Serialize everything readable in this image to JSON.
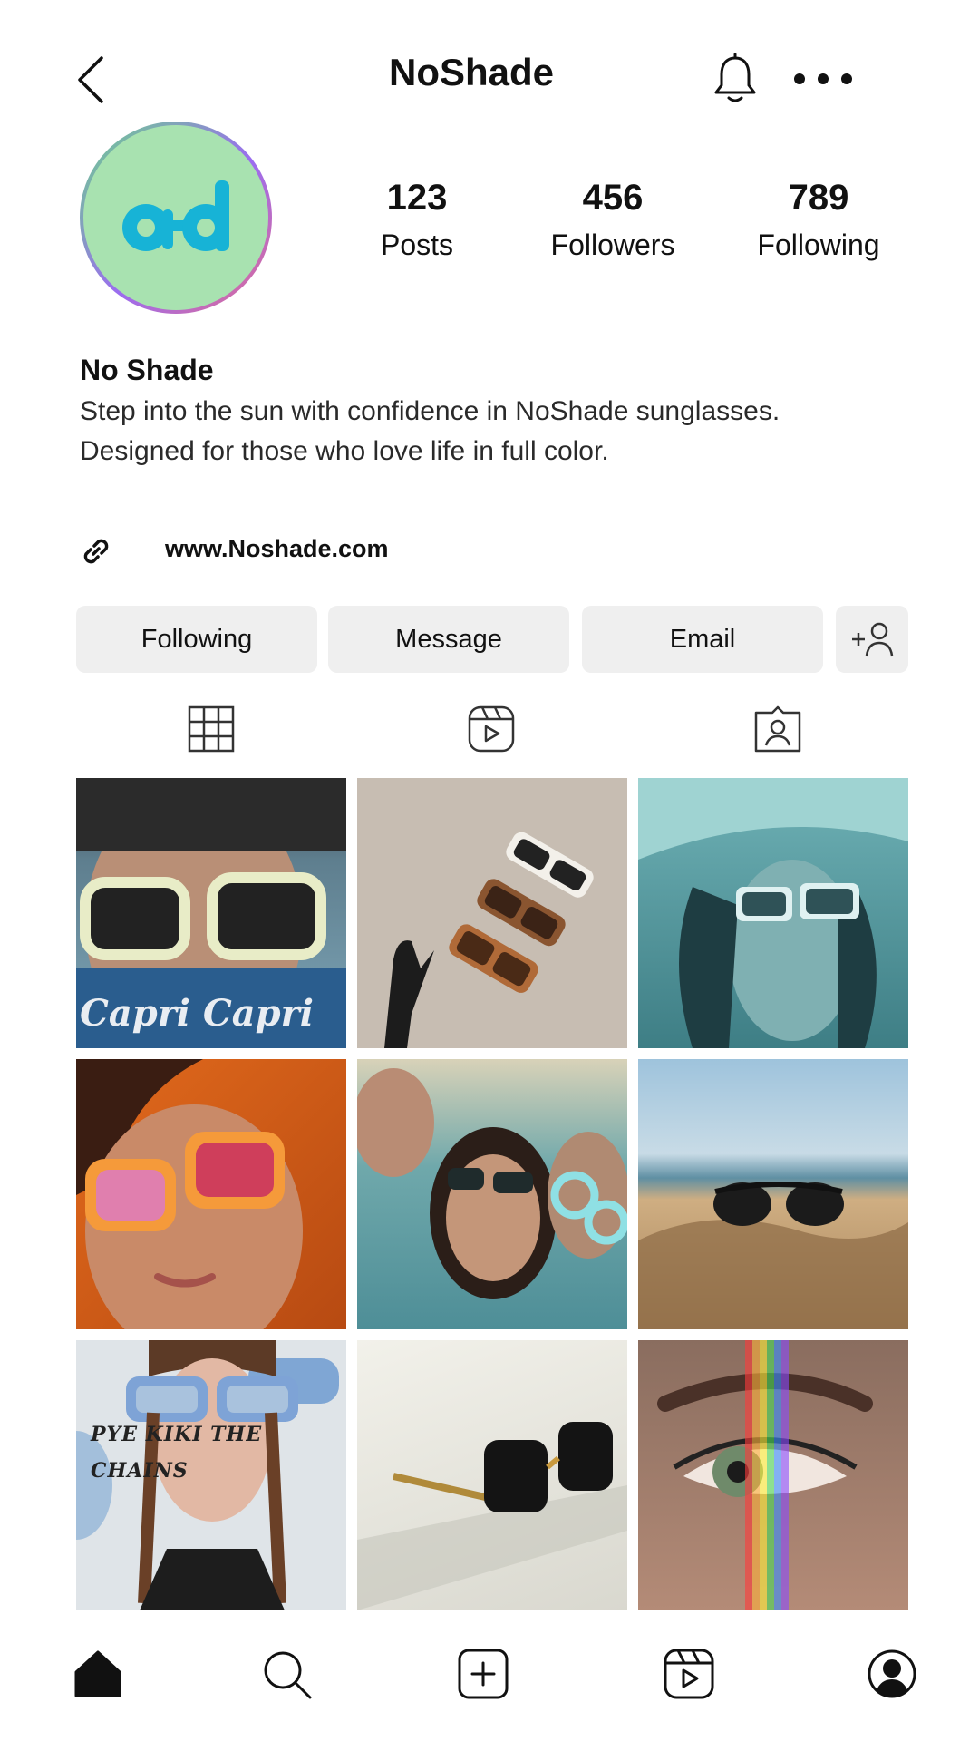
{
  "header": {
    "title": "NoShade",
    "back_icon": "chevron-left-icon",
    "bell_icon": "bell-icon",
    "more_icon": "more-horizontal-icon"
  },
  "profile": {
    "avatar_text": "a-d",
    "avatar_colors": {
      "ring_start": "#6bd48a",
      "ring_end": "#9b6cf0",
      "fill": "#a8e2b0",
      "glyph": "#17b3d6"
    },
    "stats": [
      {
        "value": "123",
        "label": "Posts"
      },
      {
        "value": "456",
        "label": "Followers"
      },
      {
        "value": "789",
        "label": "Following"
      }
    ],
    "name": "No Shade",
    "bio": "Step into the sun with confidence in NoShade sunglasses. Designed for those who love life in full color.",
    "website": "www.Noshade.com"
  },
  "actions": {
    "following": "Following",
    "message": "Message",
    "email": "Email",
    "add_user_icon": "add-user-icon"
  },
  "tabs": [
    "grid-icon",
    "reels-icon",
    "tagged-icon"
  ],
  "posts": [
    {
      "caption": "Capri Capri"
    },
    {
      "caption": ""
    },
    {
      "caption": ""
    },
    {
      "caption": ""
    },
    {
      "caption": ""
    },
    {
      "caption": ""
    },
    {
      "caption": "PYE KIKI THE CHAINS"
    },
    {
      "caption": ""
    },
    {
      "caption": ""
    }
  ],
  "bottom_nav": [
    "home-icon",
    "search-icon",
    "create-icon",
    "reels-icon",
    "profile-icon"
  ]
}
